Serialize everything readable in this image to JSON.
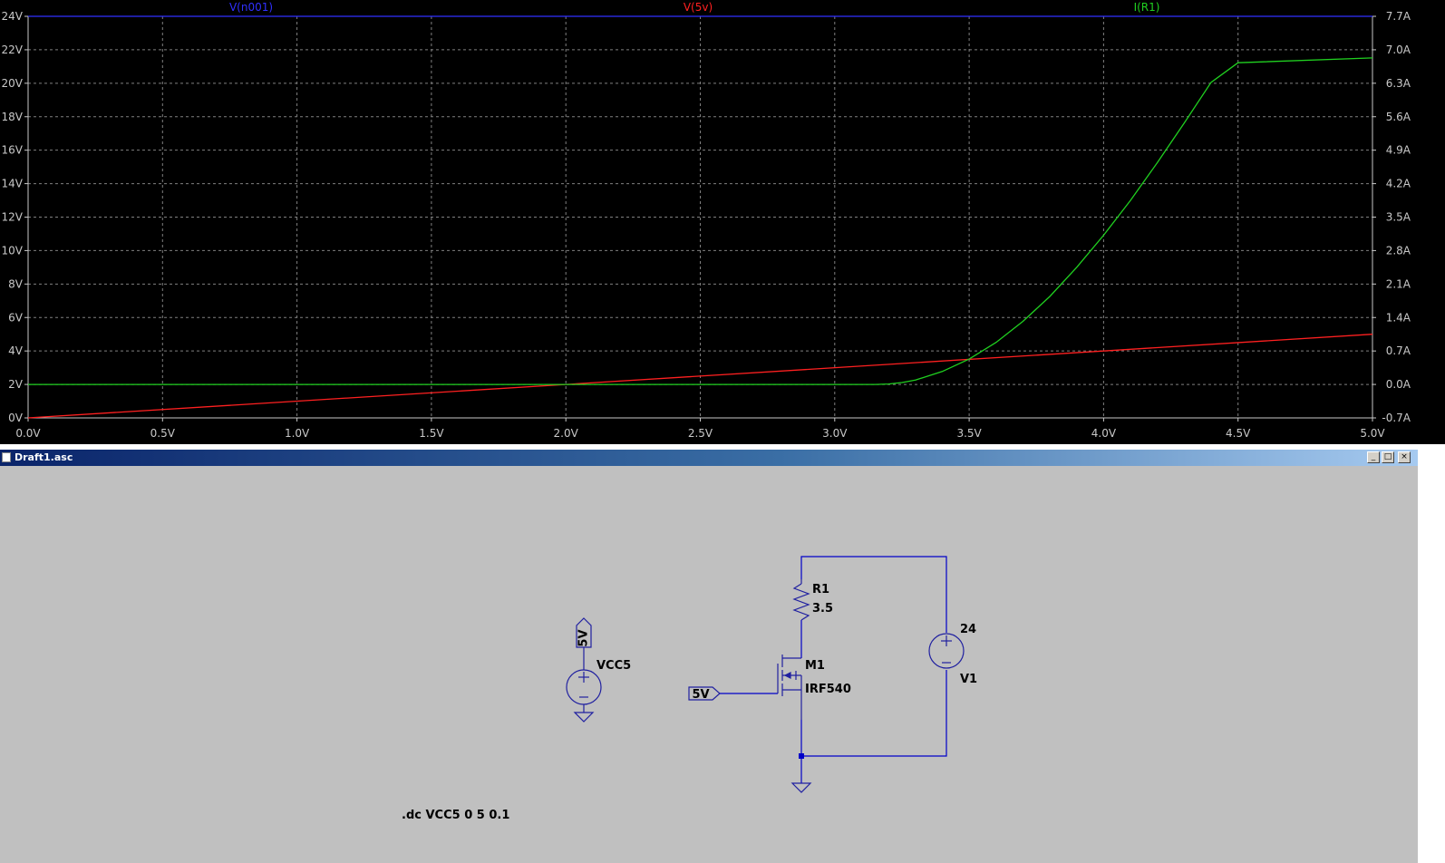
{
  "plot": {
    "traces": [
      {
        "label": "V(n001)",
        "color": "#3030ff"
      },
      {
        "label": "V(5v)",
        "color": "#ff2020"
      },
      {
        "label": "I(R1)",
        "color": "#20d020"
      }
    ],
    "colors": {
      "background": "#000000",
      "grid": "#808080",
      "tick_text": "#c8c8c8"
    }
  },
  "chart_data": {
    "type": "line",
    "x_ticks": [
      "0.0V",
      "0.5V",
      "1.0V",
      "1.5V",
      "2.0V",
      "2.5V",
      "3.0V",
      "3.5V",
      "4.0V",
      "4.5V",
      "5.0V"
    ],
    "y_left_ticks": [
      "0V",
      "2V",
      "4V",
      "6V",
      "8V",
      "10V",
      "12V",
      "14V",
      "16V",
      "18V",
      "20V",
      "22V",
      "24V"
    ],
    "y_right_ticks": [
      "-0.7A",
      "0.0A",
      "0.7A",
      "1.4A",
      "2.1A",
      "2.8A",
      "3.5A",
      "4.2A",
      "4.9A",
      "5.6A",
      "6.3A",
      "7.0A",
      "7.7A"
    ],
    "xlim": [
      0,
      5
    ],
    "ylim_left": [
      0,
      24
    ],
    "ylim_right": [
      -0.7,
      7.7
    ],
    "grid": true,
    "series": [
      {
        "name": "V(n001)",
        "axis": "left",
        "x": [
          0,
          5
        ],
        "y": [
          24,
          24
        ]
      },
      {
        "name": "V(5v)",
        "axis": "left",
        "x": [
          0,
          5
        ],
        "y": [
          0,
          5
        ]
      },
      {
        "name": "I(R1)",
        "axis": "right",
        "x": [
          0,
          3.0,
          3.15,
          3.2,
          3.25,
          3.3,
          3.4,
          3.5,
          3.6,
          3.7,
          3.8,
          3.9,
          4.0,
          4.1,
          4.2,
          4.3,
          4.4,
          4.5,
          5.0
        ],
        "y": [
          0,
          0,
          0,
          0.01,
          0.04,
          0.09,
          0.27,
          0.53,
          0.88,
          1.32,
          1.84,
          2.45,
          3.12,
          3.85,
          4.64,
          5.47,
          6.32,
          6.73,
          6.83
        ]
      }
    ]
  },
  "window": {
    "title": "Draft1.asc",
    "minimize_glyph": "_",
    "restore_glyph": "□",
    "close_glyph": "×"
  },
  "schematic": {
    "vcc5_label": "VCC5",
    "vcc5_netflag": "5V",
    "gate_netflag": "5V",
    "r1_name": "R1",
    "r1_value": "3.5",
    "m1_name": "M1",
    "m1_model": "IRF540",
    "v1_name": "V1",
    "v1_value": "24",
    "directive": ".dc VCC5 0 5 0.1",
    "colors": {
      "background": "#c0c0c0",
      "wire": "#0000c8",
      "symbol": "#2020a0"
    }
  }
}
